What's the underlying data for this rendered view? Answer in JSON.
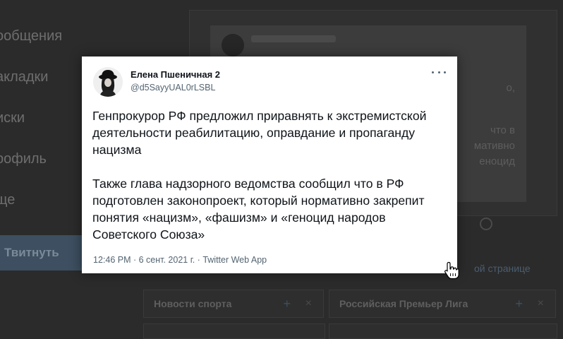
{
  "background": {
    "sidebar_items": [
      "ообщения",
      "акладки",
      "иски",
      "рофиль",
      "ще"
    ],
    "tweet_button_label": "Твитнуть",
    "embed_text_fragments": [
      "о,",
      "что в",
      "мативно",
      "еноцид"
    ],
    "show_translation": "ой странице",
    "trends": [
      "Новости спорта",
      "Российская Премьер Лига"
    ]
  },
  "tweet": {
    "display_name": "Елена Пшеничная 2",
    "handle": "@d5SayyUAL0rLSBL",
    "paragraph1": "Генпрокурор РФ предложил приравнять к экстремистской деятельности реабилитацию, оправдание и пропаганду нацизма",
    "paragraph2": "Также глава надзорного ведомства сообщил что в РФ подготовлен законопроект, который нормативно закрепит понятия «нацизм», «фашизм» и «геноцид народов Советского Союза»",
    "meta": "12:46 PM · 6 сент. 2021 г. · Twitter Web App"
  },
  "icons": {
    "more": "more-icon",
    "cursor": "hand-pointer-cursor-icon",
    "avatar": "avatar"
  },
  "colors": {
    "card_background": "#ffffff",
    "text_primary": "#0f1419",
    "text_secondary": "#536471",
    "page_background": "#2b2b2b"
  }
}
